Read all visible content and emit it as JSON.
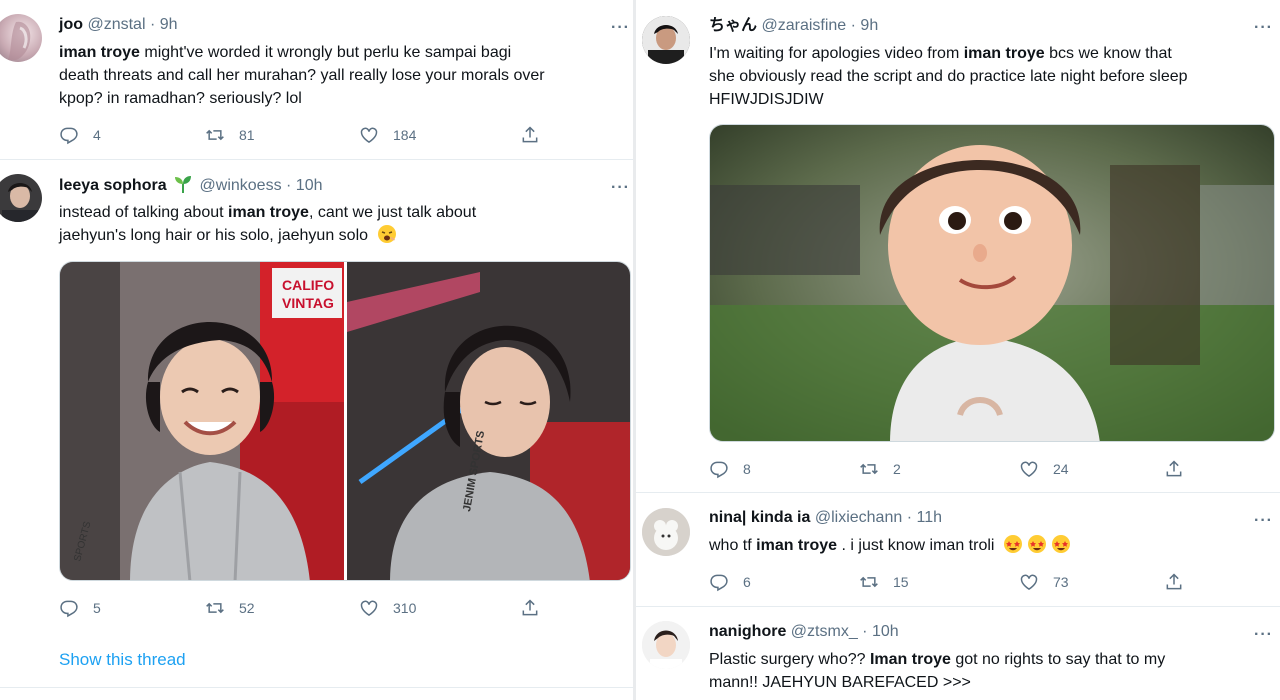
{
  "left": {
    "tweet1": {
      "name": "joo",
      "handle": "@znstal",
      "sep": "·",
      "time": "9h",
      "text_bold": "iman troye",
      "text_1": " might've worded it wrongly but perlu ke sampai bagi",
      "text_2": "death threats and call her murahan? yall really lose your morals over",
      "text_3": "kpop? in ramadhan? seriously? lol",
      "replies": "4",
      "retweets": "81",
      "likes": "184",
      "more": "···"
    },
    "tweet2": {
      "name": "leeya sophora",
      "emoji_icon": "seedling-icon",
      "handle": "@winkoess",
      "sep": "·",
      "time": "10h",
      "text_1": "instead of talking about ",
      "text_bold": "iman troye",
      "text_2": ", cant we just talk about",
      "text_3": "jaehyun's long hair or his solo, jaehyun solo",
      "replies": "5",
      "retweets": "52",
      "likes": "310",
      "more": "···",
      "show_thread": "Show this thread",
      "photo_left_text": "JENIM SPORTS",
      "photo_right_text": "JENIM SPORTS",
      "sign_text": "CALIFO VINTAG"
    }
  },
  "right": {
    "tweet1": {
      "name": "ちゃん",
      "handle": "@zaraisfine",
      "sep": "·",
      "time": "9h",
      "text_1": "I'm waiting for apologies video from ",
      "text_bold": "iman troye",
      "text_2": " bcs we know that",
      "text_3": "she obviously read the script and do practice late night before sleep",
      "text_4": "HFIWJDISJDIW",
      "replies": "8",
      "retweets": "2",
      "likes": "24",
      "more": "···"
    },
    "tweet2": {
      "name": "nina| kinda ia",
      "handle": "@lixiechann",
      "sep": "·",
      "time": "11h",
      "text_1": "who tf ",
      "text_bold": "iman troye",
      "text_2": " . i just know iman troli",
      "emoji": "🤩🤩🤩",
      "replies": "6",
      "retweets": "15",
      "likes": "73",
      "more": "···"
    },
    "tweet3": {
      "name": "nanighore",
      "handle": "@ztsmx_",
      "sep": "·",
      "time": "10h",
      "text_1": "Plastic surgery who?? ",
      "text_bold": "Iman troye",
      "text_2": " got no rights to say that to my",
      "text_3": "mann!! JAEHYUN BAREFACED >>>",
      "more": "···"
    }
  },
  "colors": {
    "link": "#1da1f2",
    "muted": "#5b7083",
    "text": "#0f1419",
    "divider": "#e6ecf0"
  }
}
